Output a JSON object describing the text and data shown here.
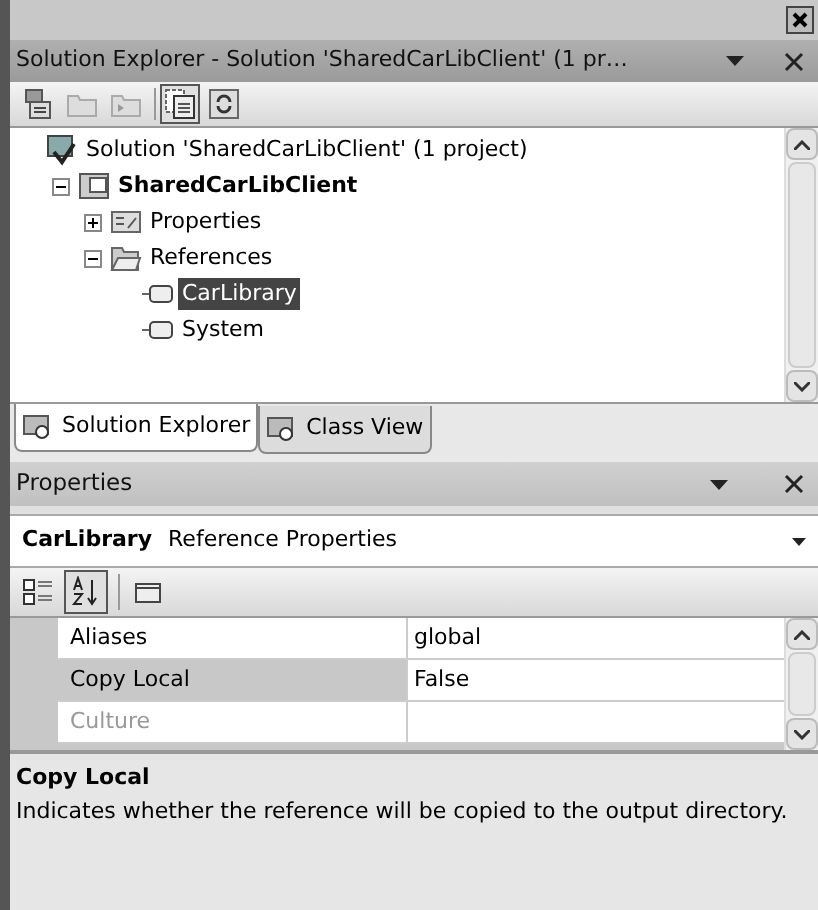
{
  "solution_explorer": {
    "title": "Solution Explorer - Solution 'SharedCarLibClient' (1 pr…",
    "toolbar": [
      {
        "kind": "properties",
        "selected": false
      },
      {
        "kind": "folder",
        "selected": false
      },
      {
        "kind": "folder-arrow",
        "selected": false
      },
      {
        "kind": "show-all",
        "selected": true
      },
      {
        "kind": "refresh",
        "selected": false
      }
    ],
    "tree": [
      {
        "label": "Solution 'SharedCarLibClient' (1 project)",
        "kind": "solution",
        "bold": false,
        "selected": false,
        "children": [
          {
            "label": "SharedCarLibClient",
            "kind": "project",
            "bold": true,
            "selected": false,
            "expanded": true,
            "children": [
              {
                "label": "Properties",
                "kind": "properties",
                "bold": false,
                "selected": false,
                "expanded": false
              },
              {
                "label": "References",
                "kind": "folder",
                "bold": false,
                "selected": false,
                "expanded": true,
                "children": [
                  {
                    "label": "CarLibrary",
                    "kind": "reference",
                    "bold": false,
                    "selected": true
                  },
                  {
                    "label": "System",
                    "kind": "reference",
                    "bold": false,
                    "selected": false
                  }
                ]
              }
            ]
          }
        ]
      }
    ],
    "tabs": [
      {
        "label": "Solution Explorer",
        "selected": true
      },
      {
        "label": "Class View",
        "selected": false
      }
    ]
  },
  "properties": {
    "title": "Properties",
    "object_name": "CarLibrary",
    "object_type": "Reference Properties",
    "toolbar": [
      {
        "kind": "categorized",
        "selected": false
      },
      {
        "kind": "alphabetical",
        "selected": true
      },
      {
        "kind": "property-pages",
        "selected": false
      }
    ],
    "rows": [
      {
        "name": "Aliases",
        "value": "global",
        "selected": false,
        "disabled": false
      },
      {
        "name": "Copy Local",
        "value": "False",
        "selected": true,
        "disabled": false
      },
      {
        "name": "Culture",
        "value": "",
        "selected": false,
        "disabled": true
      }
    ],
    "description": {
      "title": "Copy Local",
      "text": "Indicates whether the reference will be copied to the output directory."
    }
  }
}
